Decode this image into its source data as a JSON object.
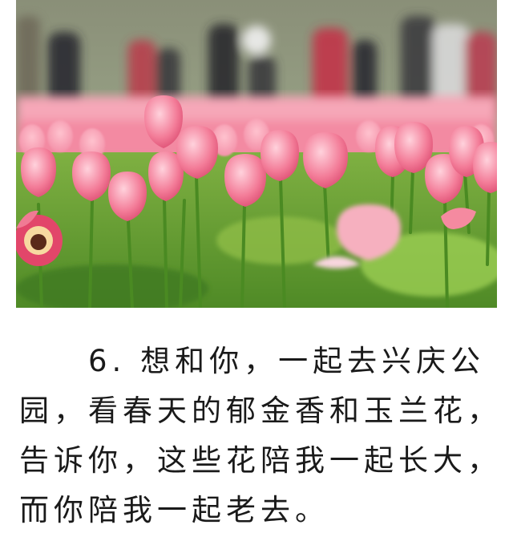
{
  "article": {
    "lines": [
      "6. 想和你，一起去兴庆公",
      "园，看春天的郁金香和玉兰花，",
      "告诉你，这些花陪我一起长大，",
      "而你陪我一起老去。"
    ]
  },
  "photo": {
    "subject": "tulip-field-photo"
  }
}
